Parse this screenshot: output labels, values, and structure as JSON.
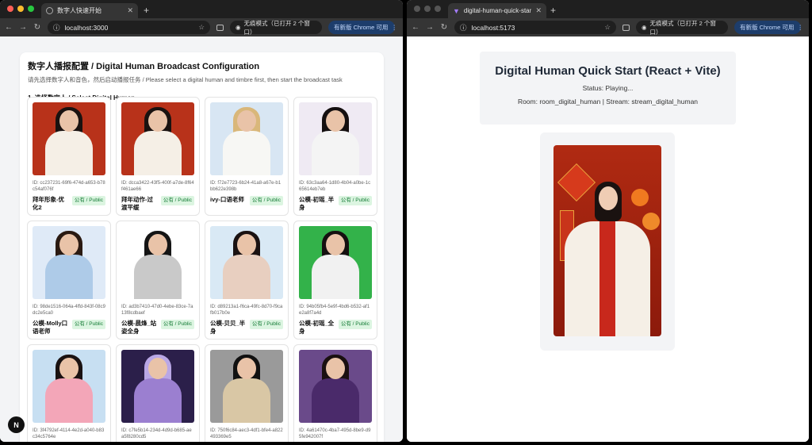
{
  "left_window": {
    "tab_title": "数字人快速开始",
    "address": "localhost:3000",
    "incognito": "无痕模式（已打开 2 个窗口）",
    "update": "有新版 Chrome 可用",
    "page": {
      "title": "数字人播报配置 / Digital Human Broadcast Configuration",
      "subtitle": "请先选择数字人和音色，然后启动播报任务 / Please select a digital human and timbre first, then start the broadcast task",
      "section": "1. 选择数字人 / Select Digital Human",
      "badge": "N",
      "humans": [
        {
          "id": "ID: cc237231-69f6-474d-a653-b78c54af076f",
          "name": "拜年形象-优化2",
          "tag": "公有 / Public",
          "bg": "#b8321a",
          "outfit": "#f5efe6",
          "hair": "#1a1210"
        },
        {
          "id": "ID: dcca3422-43f5-400f-a7de-8f64f461ae66",
          "name": "拜年动作-过渡平缓",
          "tag": "公有 / Public",
          "bg": "#b8321a",
          "outfit": "#f5efe6",
          "hair": "#1a1210"
        },
        {
          "id": "ID: f72e7723-6b24-41a8-a67e-b1bb622e398b",
          "name": "ivy-口语老师",
          "tag": "公有 / Public",
          "bg": "#d8e6f3",
          "outfit": "#f7f7f4",
          "hair": "#d9b77a"
        },
        {
          "id": "ID: 63c3aa64-1d80-4b04-a0be-1c65614eb7eb",
          "name": "公模-初瑶_半身",
          "tag": "公有 / Public",
          "bg": "#efeaf3",
          "outfit": "#f4f4f4",
          "hair": "#151010"
        },
        {
          "id": "ID: 98de1516-064a-4ffd-843f-08c9dc2e5ca0",
          "name": "公模-Molly口语老师",
          "tag": "公有 / Public",
          "bg": "#dfeaf7",
          "outfit": "#aecbe8",
          "hair": "#2a1a12"
        },
        {
          "id": "ID: ad3b7410-47d0-4ebe-83ce-7a13f8cdbaef",
          "name": "公模-晨烽_站姿全身",
          "tag": "公有 / Public",
          "bg": "#ffffff",
          "outfit": "#c9c9c9",
          "hair": "#151515"
        },
        {
          "id": "ID: d89213a1-f6ca-49fc-8d70-f9cafb017b0e",
          "name": "公模-贝贝_半身",
          "tag": "公有 / Public",
          "bg": "#d9e9f5",
          "outfit": "#e8cfc0",
          "hair": "#1a1212"
        },
        {
          "id": "ID: 94b05fb4-5e9f-4bd6-b532-af1e2a8f7a4d",
          "name": "公模-初瑶_全身",
          "tag": "公有 / Public",
          "bg": "#33b24a",
          "outfit": "#f1f1f1",
          "hair": "#151010"
        },
        {
          "id": "ID: 3f4792ef-4114-4e2d-a040-b83c34c5764e",
          "name": "",
          "tag": "",
          "bg": "#c7dff2",
          "outfit": "#f3a6b8",
          "hair": "#1a1212"
        },
        {
          "id": "ID: c7fe5b14-234d-4d9d-b685-aea5f8280cd5",
          "name": "",
          "tag": "",
          "bg": "#2b1f4a",
          "outfit": "#9b7fd0",
          "hair": "#b9a7e6"
        },
        {
          "id": "ID: 750f6c84-aec3-4df1-bfe4-a822493369e5",
          "name": "",
          "tag": "",
          "bg": "#9a9a9a",
          "outfit": "#d9c7a5",
          "hair": "#111111"
        },
        {
          "id": "ID: 4a61470c-4ba7-495d-8be9-d95fe942007f",
          "name": "",
          "tag": "",
          "bg": "#6a4a8a",
          "outfit": "#4a2a6a",
          "hair": "#1a1010"
        }
      ]
    }
  },
  "right_window": {
    "tab_title": "digital-human-quick-start-vi",
    "address": "localhost:5173",
    "incognito": "无痕模式（已打开 2 个窗口）",
    "update": "有新版 Chrome 可用",
    "page": {
      "title": "Digital Human Quick Start (React + Vite)",
      "status": "Status: Playing...",
      "room_stream": "Room: room_digital_human | Stream: stream_digital_human"
    }
  }
}
